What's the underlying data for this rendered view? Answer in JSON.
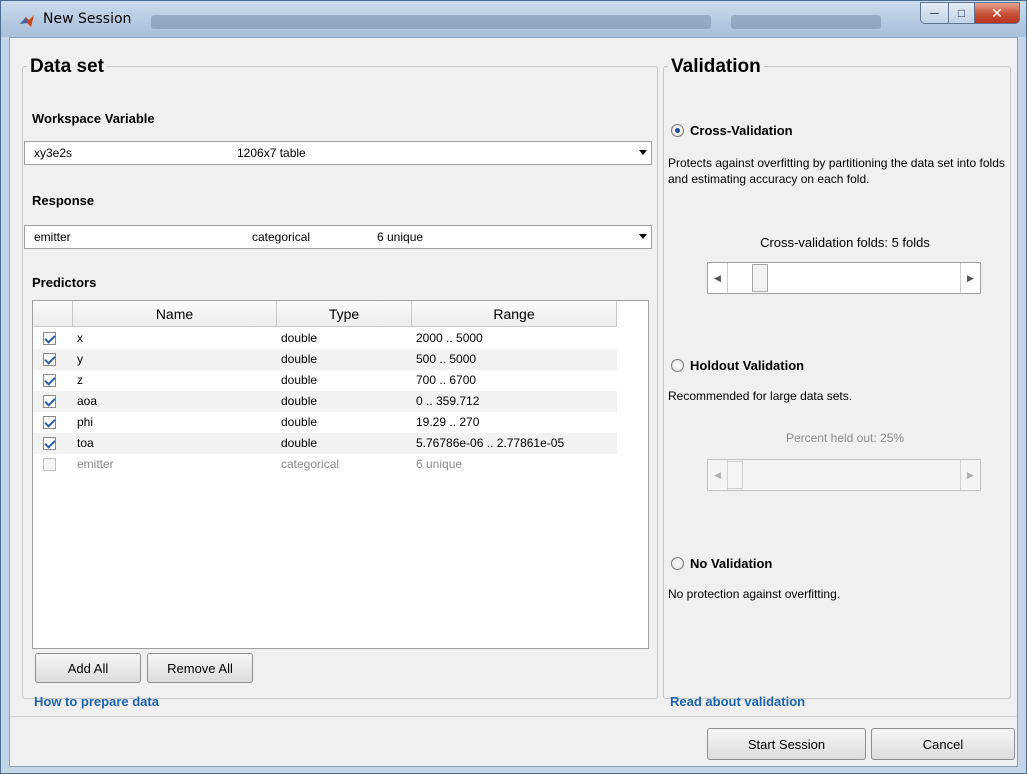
{
  "window": {
    "title": "New Session",
    "accent": "#1d63b5"
  },
  "dataset": {
    "legend": "Data set",
    "workspace_label": "Workspace Variable",
    "workspace_combo": {
      "name": "xy3e2s",
      "size": "1206x7 table"
    },
    "response_label": "Response",
    "response_combo": {
      "name": "emitter",
      "type": "categorical",
      "info": "6 unique"
    },
    "predictors_label": "Predictors",
    "table": {
      "headers": [
        "Name",
        "Type",
        "Range"
      ],
      "rows": [
        {
          "checked": true,
          "enabled": true,
          "name": "x",
          "type": "double",
          "range": "2000 .. 5000"
        },
        {
          "checked": true,
          "enabled": true,
          "name": "y",
          "type": "double",
          "range": "500 .. 5000"
        },
        {
          "checked": true,
          "enabled": true,
          "name": "z",
          "type": "double",
          "range": "700 .. 6700"
        },
        {
          "checked": true,
          "enabled": true,
          "name": "aoa",
          "type": "double",
          "range": "0 .. 359.712"
        },
        {
          "checked": true,
          "enabled": true,
          "name": "phi",
          "type": "double",
          "range": "19.29 .. 270"
        },
        {
          "checked": true,
          "enabled": true,
          "name": "toa",
          "type": "double",
          "range": "5.76786e-06 .. 2.77861e-05"
        },
        {
          "checked": false,
          "enabled": false,
          "name": "emitter",
          "type": "categorical",
          "range": "6 unique"
        }
      ]
    },
    "add_all": "Add All",
    "remove_all": "Remove All",
    "help_link": "How to prepare data"
  },
  "validation": {
    "legend": "Validation",
    "cross": {
      "label": "Cross-Validation",
      "selected": true,
      "description": "Protects against overfitting by partitioning the data set into folds and estimating accuracy on each fold.",
      "slider_caption": "Cross-validation folds: 5 folds",
      "slider_value": 5
    },
    "holdout": {
      "label": "Holdout Validation",
      "selected": false,
      "description": "Recommended for large data sets.",
      "slider_caption": "Percent held out: 25%",
      "slider_value": 25
    },
    "none": {
      "label": "No Validation",
      "selected": false,
      "description": "No protection against overfitting."
    },
    "help_link": "Read about validation"
  },
  "footer": {
    "start": "Start Session",
    "cancel": "Cancel"
  }
}
